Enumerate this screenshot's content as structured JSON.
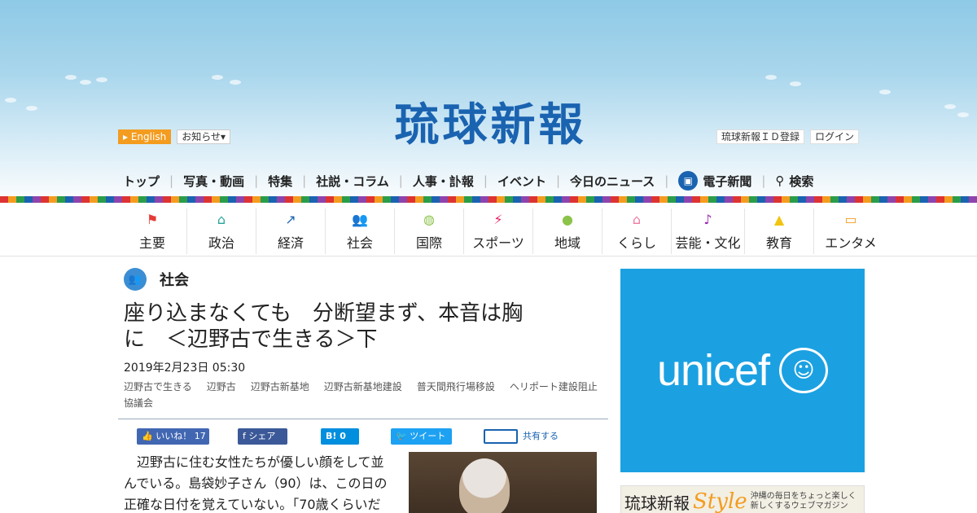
{
  "header": {
    "english_label": "English",
    "notice_label": "お知らせ▾",
    "logo_text": "琉球新報",
    "id_register_label": "琉球新報ＩＤ登録",
    "login_label": "ログイン"
  },
  "main_nav": [
    {
      "label": "トップ"
    },
    {
      "label": "写真・動画"
    },
    {
      "label": "特集"
    },
    {
      "label": "社説・コラム"
    },
    {
      "label": "人事・訃報"
    },
    {
      "label": "イベント"
    },
    {
      "label": "今日のニュース"
    },
    {
      "label": "電子新聞",
      "icon": "digital-paper-icon"
    },
    {
      "label": "検索",
      "icon": "search-icon"
    }
  ],
  "category_nav": [
    {
      "label": "主要",
      "icon": "flag-icon",
      "color": "#e53935"
    },
    {
      "label": "政治",
      "icon": "parliament-icon",
      "color": "#26a69a"
    },
    {
      "label": "経済",
      "icon": "chart-line-icon",
      "color": "#1a63b0"
    },
    {
      "label": "社会",
      "icon": "people-icon",
      "color": "#3b8ed3"
    },
    {
      "label": "国際",
      "icon": "globe-icon",
      "color": "#8bc34a"
    },
    {
      "label": "スポーツ",
      "icon": "runner-icon",
      "color": "#e91e63"
    },
    {
      "label": "地域",
      "icon": "map-pin-icon",
      "color": "#8bc34a"
    },
    {
      "label": "くらし",
      "icon": "house-icon",
      "color": "#ef7aa0"
    },
    {
      "label": "芸能・文化",
      "icon": "sanshin-icon",
      "color": "#9c27b0"
    },
    {
      "label": "教育",
      "icon": "graduation-cap-icon",
      "color": "#f1c40f"
    },
    {
      "label": "エンタメ",
      "icon": "tv-icon",
      "color": "#f39c1f"
    }
  ],
  "article": {
    "section_label": "社会",
    "title_line1": "座り込まなくても　分断望まず、本音は胸",
    "title_line2": "に　＜辺野古で生きる＞下",
    "date": "2019年2月23日 05:30",
    "tags": [
      "辺野古で生きる",
      "辺野古",
      "辺野古新基地",
      "辺野古新基地建設",
      "普天間飛行場移設",
      "ヘリポート建設阻止協議会"
    ],
    "body": "辺野古に住む女性たちが優しい顔をして並んでいる。島袋妙子さん（90）は、この日の正確な日付を覚えていない。「70歳くらいだ"
  },
  "share": {
    "like_label": "いいね！ 17",
    "fb_label": "シェア",
    "hatena_label": "B! 0",
    "tweet_label": "ツイート",
    "share_label": "共有する"
  },
  "ads": {
    "unicef_text": "unicef",
    "style_name": "琉球新報",
    "style_word": "Style",
    "style_tagline": "沖縄の毎日をちょっと楽しく新しくするウェブマガジン"
  }
}
